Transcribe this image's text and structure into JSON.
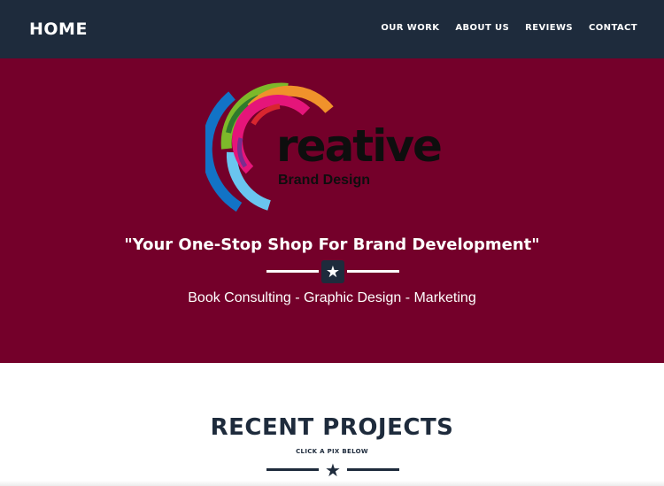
{
  "navbar": {
    "brand": "HOME",
    "links": [
      "OUR WORK",
      "ABOUT US",
      "REVIEWS",
      "CONTACT"
    ]
  },
  "hero": {
    "logo_word": "reative",
    "logo_sub": "Brand Design",
    "tagline": "\"Your One-Stop Shop For Brand Development\"",
    "services": "Book Consulting - Graphic Design - Marketing",
    "divider_icon": "star-icon"
  },
  "projects": {
    "title": "RECENT PROJECTS",
    "subtitle": "CLICK A PIX BELOW",
    "divider_icon": "star-icon"
  },
  "colors": {
    "navbar": "#1e2b3c",
    "hero": "#74002a",
    "accent_dark": "#1e2b3c",
    "text_light": "#ffffff"
  }
}
